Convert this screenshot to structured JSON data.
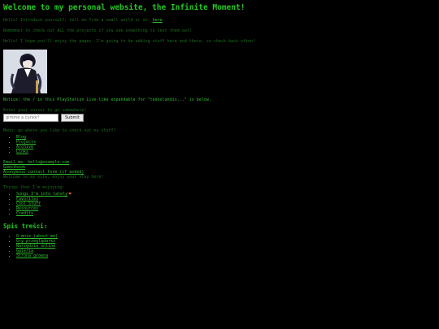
{
  "page": {
    "title": "Welcome to my personal website, the Infinite Moment!",
    "intro_lines": [
      "Hello! Introduce yourself, tell me from a small world or so.",
      "Remember to check out ALL the projects if you see something to test them out!",
      "Hello! I hope you'll enjoy the pages. I'm going to be adding stuff here and there, so check back often!"
    ],
    "intro_link": "here",
    "avatar_alt": "avatar illustration",
    "notice_text": "Notice: the / in this PlayStation Live-like expandable for \"tedoolandis...\" is below.",
    "form": {
      "label": "Enter your cursor to go somewhere!",
      "input_placeholder": "gimme a cursor!",
      "submit_label": "Submit"
    },
    "main_menu_label": "Menu: go where you like to check out my stuff!",
    "main_menu": [
      "Blog",
      "Projects",
      "Archive",
      "Links"
    ],
    "contact_block": [
      "Email me: hello@example.com",
      "Guestbook",
      "Anonymous contact form (if asked)",
      "Welcome to my site, enjoy your stay here!"
    ],
    "favorites_label": "Things that I'm enjoying:",
    "favorites": [
      "Songs I'm into lately",
      "Favorites",
      "Cool Stuff",
      "Resources",
      "Credits"
    ],
    "section_title": "Spis treści:",
    "toc": [
      "O mnie (about me)",
      "Gry przeglądarki",
      "Narzędzia online",
      "Galeria",
      "Strona główna"
    ]
  }
}
